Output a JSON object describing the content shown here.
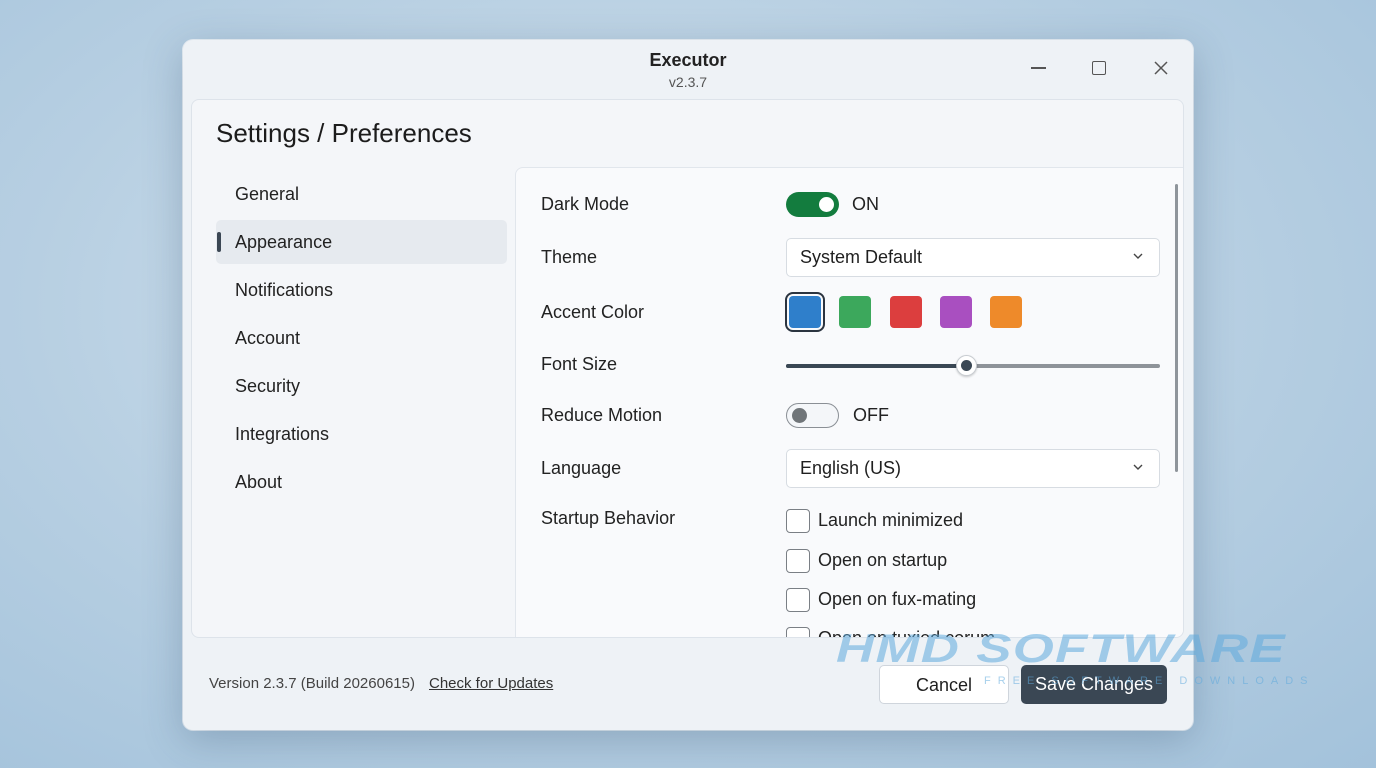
{
  "window": {
    "title": "Executor",
    "subtitle": "v2.3.7"
  },
  "page": {
    "title": "Settings / Preferences"
  },
  "nav": {
    "items": [
      {
        "label": "General"
      },
      {
        "label": "Appearance"
      },
      {
        "label": "Notifications"
      },
      {
        "label": "Account"
      },
      {
        "label": "Security"
      },
      {
        "label": "Integrations"
      },
      {
        "label": "About"
      }
    ],
    "active": "Appearance"
  },
  "settings": {
    "dark_mode": {
      "label": "Dark Mode",
      "state": "ON"
    },
    "theme": {
      "label": "Theme",
      "value": "System Default"
    },
    "accent": {
      "label": "Accent Color",
      "colors": [
        "#2f7fcb",
        "#3ca85c",
        "#dc3e3e",
        "#a94fc0",
        "#ee8a2a"
      ],
      "selected": "#2f7fcb"
    },
    "font_size": {
      "label": "Font Size",
      "value_fraction": 0.48
    },
    "reduce_motion": {
      "label": "Reduce Motion",
      "state": "OFF"
    },
    "language": {
      "label": "Language",
      "value": "English (US)"
    },
    "startup": {
      "label": "Startup Behavior",
      "options": [
        {
          "label": "Launch minimized"
        },
        {
          "label": "Open on startup"
        },
        {
          "label": "Open on fux-mating"
        },
        {
          "label": "Open on tuxied corum"
        }
      ]
    }
  },
  "footer": {
    "version": "Version 2.3.7 (Build 20260615)",
    "update_link": "Check for Updates",
    "cancel": "Cancel",
    "save": "Save Changes"
  },
  "watermark": {
    "main": "HMD SOFTWARE",
    "sub": "FREE SOFTWARE DOWNLOADS"
  }
}
